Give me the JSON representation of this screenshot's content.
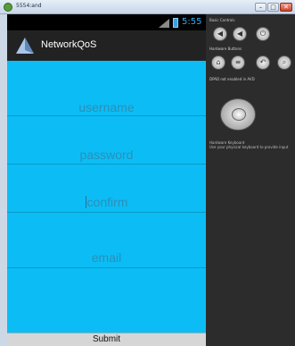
{
  "window": {
    "title": "5554:and",
    "minimize": "–",
    "maximize": "□",
    "close": "✕"
  },
  "status_bar": {
    "clock": "5:55",
    "network_type": "3G"
  },
  "action_bar": {
    "title": "NetworkQoS"
  },
  "form": {
    "fields": [
      {
        "placeholder": "username"
      },
      {
        "placeholder": "password"
      },
      {
        "placeholder": "confirm"
      },
      {
        "placeholder": "email"
      }
    ],
    "submit_label": "Submit"
  },
  "controls_panel": {
    "basic_controls_title": "Basic Controls",
    "hardware_buttons_title": "Hardware Buttons",
    "dpad_title": "DPAD not enabled in AVD",
    "keyboard_title": "Hardware Keyboard",
    "keyboard_hint": "Use your physical keyboard to provide input"
  },
  "colors": {
    "form_background": "#0cbdf5",
    "action_bar": "#222222",
    "status_accent": "#37aef0"
  }
}
